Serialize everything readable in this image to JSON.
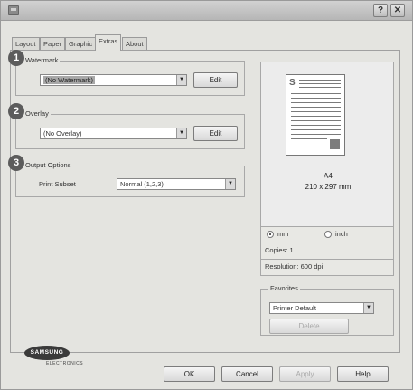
{
  "window": {
    "help_glyph": "?",
    "close_glyph": "✕"
  },
  "tabs": [
    {
      "label": "Layout",
      "active": false
    },
    {
      "label": "Paper",
      "active": false
    },
    {
      "label": "Graphic",
      "active": false
    },
    {
      "label": "Extras",
      "active": true
    },
    {
      "label": "About",
      "active": false
    }
  ],
  "watermark": {
    "badge": "1",
    "label": "Watermark",
    "value": "(No Watermark)",
    "edit_label": "Edit"
  },
  "overlay": {
    "badge": "2",
    "label": "Overlay",
    "value": "(No Overlay)",
    "edit_label": "Edit"
  },
  "output_options": {
    "badge": "3",
    "label": "Output Options",
    "print_subset_label": "Print Subset",
    "print_subset_value": "Normal (1,2,3)"
  },
  "preview": {
    "page_letter": "S",
    "paper_name": "A4",
    "paper_size": "210 x 297 mm"
  },
  "units": {
    "mm_label": "mm",
    "inch_label": "inch",
    "selected": "mm"
  },
  "copies": "Copies: 1",
  "resolution": "Resolution: 600 dpi",
  "favorites": {
    "label": "Favorites",
    "value": "Printer Default",
    "delete_label": "Delete"
  },
  "brand": {
    "name": "SAMSUNG",
    "sub": "ELECTRONICS"
  },
  "footer": {
    "ok_label": "OK",
    "cancel_label": "Cancel",
    "apply_label": "Apply",
    "help_label": "Help"
  },
  "colors": {
    "dialog_bg": "#e4e4e0",
    "badge": "#5c5c5c",
    "selection": "#a8a8a8"
  }
}
